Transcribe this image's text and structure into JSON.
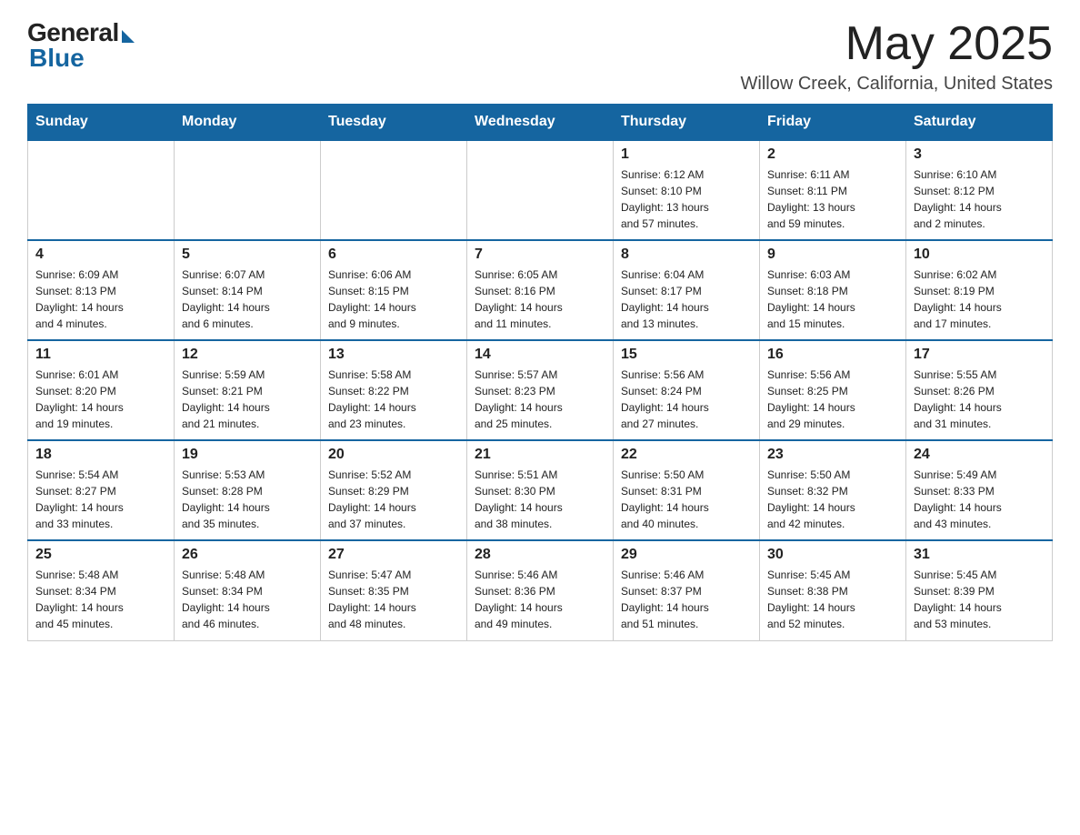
{
  "logo": {
    "general": "General",
    "blue": "Blue"
  },
  "header": {
    "month_year": "May 2025",
    "location": "Willow Creek, California, United States"
  },
  "days_of_week": [
    "Sunday",
    "Monday",
    "Tuesday",
    "Wednesday",
    "Thursday",
    "Friday",
    "Saturday"
  ],
  "weeks": [
    [
      {
        "day": "",
        "info": ""
      },
      {
        "day": "",
        "info": ""
      },
      {
        "day": "",
        "info": ""
      },
      {
        "day": "",
        "info": ""
      },
      {
        "day": "1",
        "info": "Sunrise: 6:12 AM\nSunset: 8:10 PM\nDaylight: 13 hours\nand 57 minutes."
      },
      {
        "day": "2",
        "info": "Sunrise: 6:11 AM\nSunset: 8:11 PM\nDaylight: 13 hours\nand 59 minutes."
      },
      {
        "day": "3",
        "info": "Sunrise: 6:10 AM\nSunset: 8:12 PM\nDaylight: 14 hours\nand 2 minutes."
      }
    ],
    [
      {
        "day": "4",
        "info": "Sunrise: 6:09 AM\nSunset: 8:13 PM\nDaylight: 14 hours\nand 4 minutes."
      },
      {
        "day": "5",
        "info": "Sunrise: 6:07 AM\nSunset: 8:14 PM\nDaylight: 14 hours\nand 6 minutes."
      },
      {
        "day": "6",
        "info": "Sunrise: 6:06 AM\nSunset: 8:15 PM\nDaylight: 14 hours\nand 9 minutes."
      },
      {
        "day": "7",
        "info": "Sunrise: 6:05 AM\nSunset: 8:16 PM\nDaylight: 14 hours\nand 11 minutes."
      },
      {
        "day": "8",
        "info": "Sunrise: 6:04 AM\nSunset: 8:17 PM\nDaylight: 14 hours\nand 13 minutes."
      },
      {
        "day": "9",
        "info": "Sunrise: 6:03 AM\nSunset: 8:18 PM\nDaylight: 14 hours\nand 15 minutes."
      },
      {
        "day": "10",
        "info": "Sunrise: 6:02 AM\nSunset: 8:19 PM\nDaylight: 14 hours\nand 17 minutes."
      }
    ],
    [
      {
        "day": "11",
        "info": "Sunrise: 6:01 AM\nSunset: 8:20 PM\nDaylight: 14 hours\nand 19 minutes."
      },
      {
        "day": "12",
        "info": "Sunrise: 5:59 AM\nSunset: 8:21 PM\nDaylight: 14 hours\nand 21 minutes."
      },
      {
        "day": "13",
        "info": "Sunrise: 5:58 AM\nSunset: 8:22 PM\nDaylight: 14 hours\nand 23 minutes."
      },
      {
        "day": "14",
        "info": "Sunrise: 5:57 AM\nSunset: 8:23 PM\nDaylight: 14 hours\nand 25 minutes."
      },
      {
        "day": "15",
        "info": "Sunrise: 5:56 AM\nSunset: 8:24 PM\nDaylight: 14 hours\nand 27 minutes."
      },
      {
        "day": "16",
        "info": "Sunrise: 5:56 AM\nSunset: 8:25 PM\nDaylight: 14 hours\nand 29 minutes."
      },
      {
        "day": "17",
        "info": "Sunrise: 5:55 AM\nSunset: 8:26 PM\nDaylight: 14 hours\nand 31 minutes."
      }
    ],
    [
      {
        "day": "18",
        "info": "Sunrise: 5:54 AM\nSunset: 8:27 PM\nDaylight: 14 hours\nand 33 minutes."
      },
      {
        "day": "19",
        "info": "Sunrise: 5:53 AM\nSunset: 8:28 PM\nDaylight: 14 hours\nand 35 minutes."
      },
      {
        "day": "20",
        "info": "Sunrise: 5:52 AM\nSunset: 8:29 PM\nDaylight: 14 hours\nand 37 minutes."
      },
      {
        "day": "21",
        "info": "Sunrise: 5:51 AM\nSunset: 8:30 PM\nDaylight: 14 hours\nand 38 minutes."
      },
      {
        "day": "22",
        "info": "Sunrise: 5:50 AM\nSunset: 8:31 PM\nDaylight: 14 hours\nand 40 minutes."
      },
      {
        "day": "23",
        "info": "Sunrise: 5:50 AM\nSunset: 8:32 PM\nDaylight: 14 hours\nand 42 minutes."
      },
      {
        "day": "24",
        "info": "Sunrise: 5:49 AM\nSunset: 8:33 PM\nDaylight: 14 hours\nand 43 minutes."
      }
    ],
    [
      {
        "day": "25",
        "info": "Sunrise: 5:48 AM\nSunset: 8:34 PM\nDaylight: 14 hours\nand 45 minutes."
      },
      {
        "day": "26",
        "info": "Sunrise: 5:48 AM\nSunset: 8:34 PM\nDaylight: 14 hours\nand 46 minutes."
      },
      {
        "day": "27",
        "info": "Sunrise: 5:47 AM\nSunset: 8:35 PM\nDaylight: 14 hours\nand 48 minutes."
      },
      {
        "day": "28",
        "info": "Sunrise: 5:46 AM\nSunset: 8:36 PM\nDaylight: 14 hours\nand 49 minutes."
      },
      {
        "day": "29",
        "info": "Sunrise: 5:46 AM\nSunset: 8:37 PM\nDaylight: 14 hours\nand 51 minutes."
      },
      {
        "day": "30",
        "info": "Sunrise: 5:45 AM\nSunset: 8:38 PM\nDaylight: 14 hours\nand 52 minutes."
      },
      {
        "day": "31",
        "info": "Sunrise: 5:45 AM\nSunset: 8:39 PM\nDaylight: 14 hours\nand 53 minutes."
      }
    ]
  ]
}
